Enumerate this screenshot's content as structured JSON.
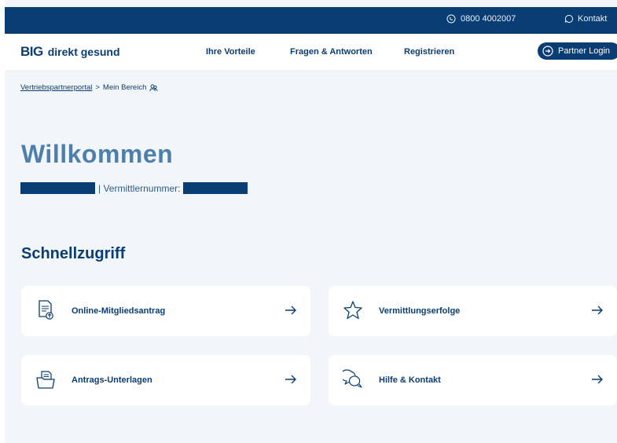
{
  "topbar": {
    "phone": "0800 4002007",
    "contact": "Kontakt"
  },
  "nav": {
    "logo_mark": "BIG",
    "logo_text": "direkt gesund",
    "links": [
      "Ihre Vorteile",
      "Fragen & Antworten",
      "Registrieren"
    ],
    "login": "Partner Login"
  },
  "breadcrumb": {
    "parent": "Vertriebspartnerportal",
    "separator": ">",
    "current": "Mein Bereich"
  },
  "welcome": {
    "title": "Willkommen",
    "id_label": "| Vermittlernummer:"
  },
  "quick": {
    "title": "Schnellzugriff",
    "cards": [
      {
        "label": "Online-Mitgliedsantrag",
        "icon": "document-upload-icon"
      },
      {
        "label": "Vermittlungserfolge",
        "icon": "star-icon"
      },
      {
        "label": "Antrags-Unterlagen",
        "icon": "folder-documents-icon"
      },
      {
        "label": "Hilfe & Kontakt",
        "icon": "chat-bubbles-icon"
      }
    ]
  },
  "colors": {
    "primary": "#0a3d74",
    "background": "#f2f6fa",
    "welcome": "#4d7fae"
  }
}
